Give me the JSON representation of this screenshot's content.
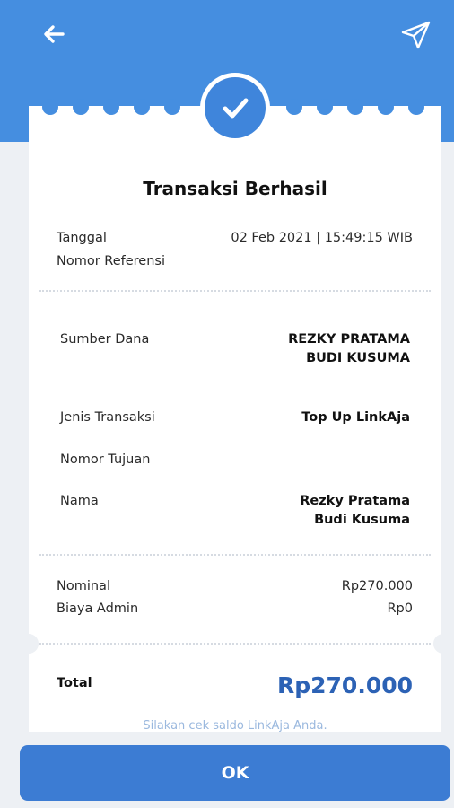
{
  "header": {
    "back_icon": "arrow-left-icon",
    "share_icon": "send-icon"
  },
  "receipt": {
    "title": "Transaksi Berhasil",
    "tanggal_label": "Tanggal",
    "tanggal_value": "02 Feb 2021 | 15:49:15 WIB",
    "referensi_label": "Nomor Referensi",
    "referensi_value": "",
    "sumber_label": "Sumber Dana",
    "sumber_value_line1": "REZKY PRATAMA",
    "sumber_value_line2": "BUDI KUSUMA",
    "jenis_label": "Jenis Transaksi",
    "jenis_value": "Top Up LinkAja",
    "tujuan_label": "Nomor Tujuan",
    "tujuan_value": "",
    "nama_label": "Nama",
    "nama_value_line1": "Rezky Pratama",
    "nama_value_line2": "Budi Kusuma",
    "nominal_label": "Nominal",
    "nominal_value": "Rp270.000",
    "admin_label": "Biaya Admin",
    "admin_value": "Rp0",
    "total_label": "Total",
    "total_value": "Rp270.000",
    "hint": "Silakan cek saldo LinkAja Anda."
  },
  "footer": {
    "ok_label": "OK"
  },
  "colors": {
    "header_blue": "#458EE0",
    "button_blue": "#3C7CD3",
    "total_blue": "#2C62B5"
  }
}
